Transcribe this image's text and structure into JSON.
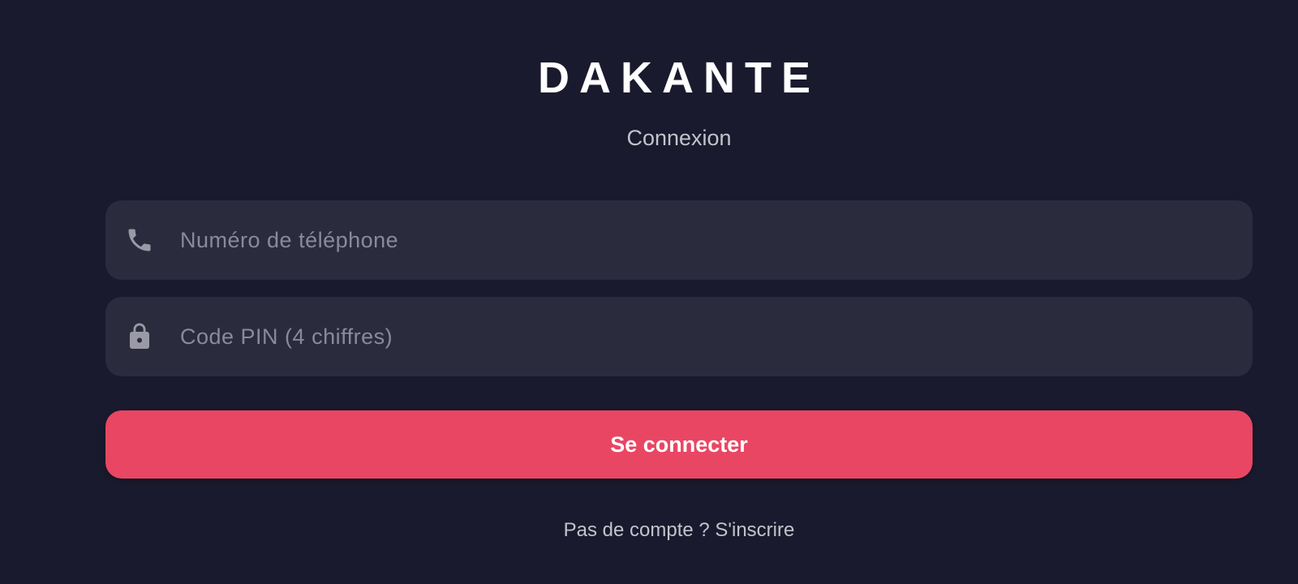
{
  "app": {
    "brand": "DAKANTE",
    "subtitle": "Connexion"
  },
  "form": {
    "phone": {
      "value": "",
      "placeholder": "Numéro de téléphone",
      "icon": "phone-icon"
    },
    "pin": {
      "value": "",
      "placeholder": "Code PIN (4 chiffres)",
      "icon": "lock-icon"
    },
    "submit_label": "Se connecter"
  },
  "footer": {
    "signup_text": "Pas de compte ? S'inscrire"
  },
  "colors": {
    "background": "#1a1a2e",
    "field_background": "#2b2b3e",
    "accent": "#e94663",
    "text_primary": "#ffffff",
    "text_muted": "#c3c3cc",
    "placeholder": "#8a8a98"
  }
}
